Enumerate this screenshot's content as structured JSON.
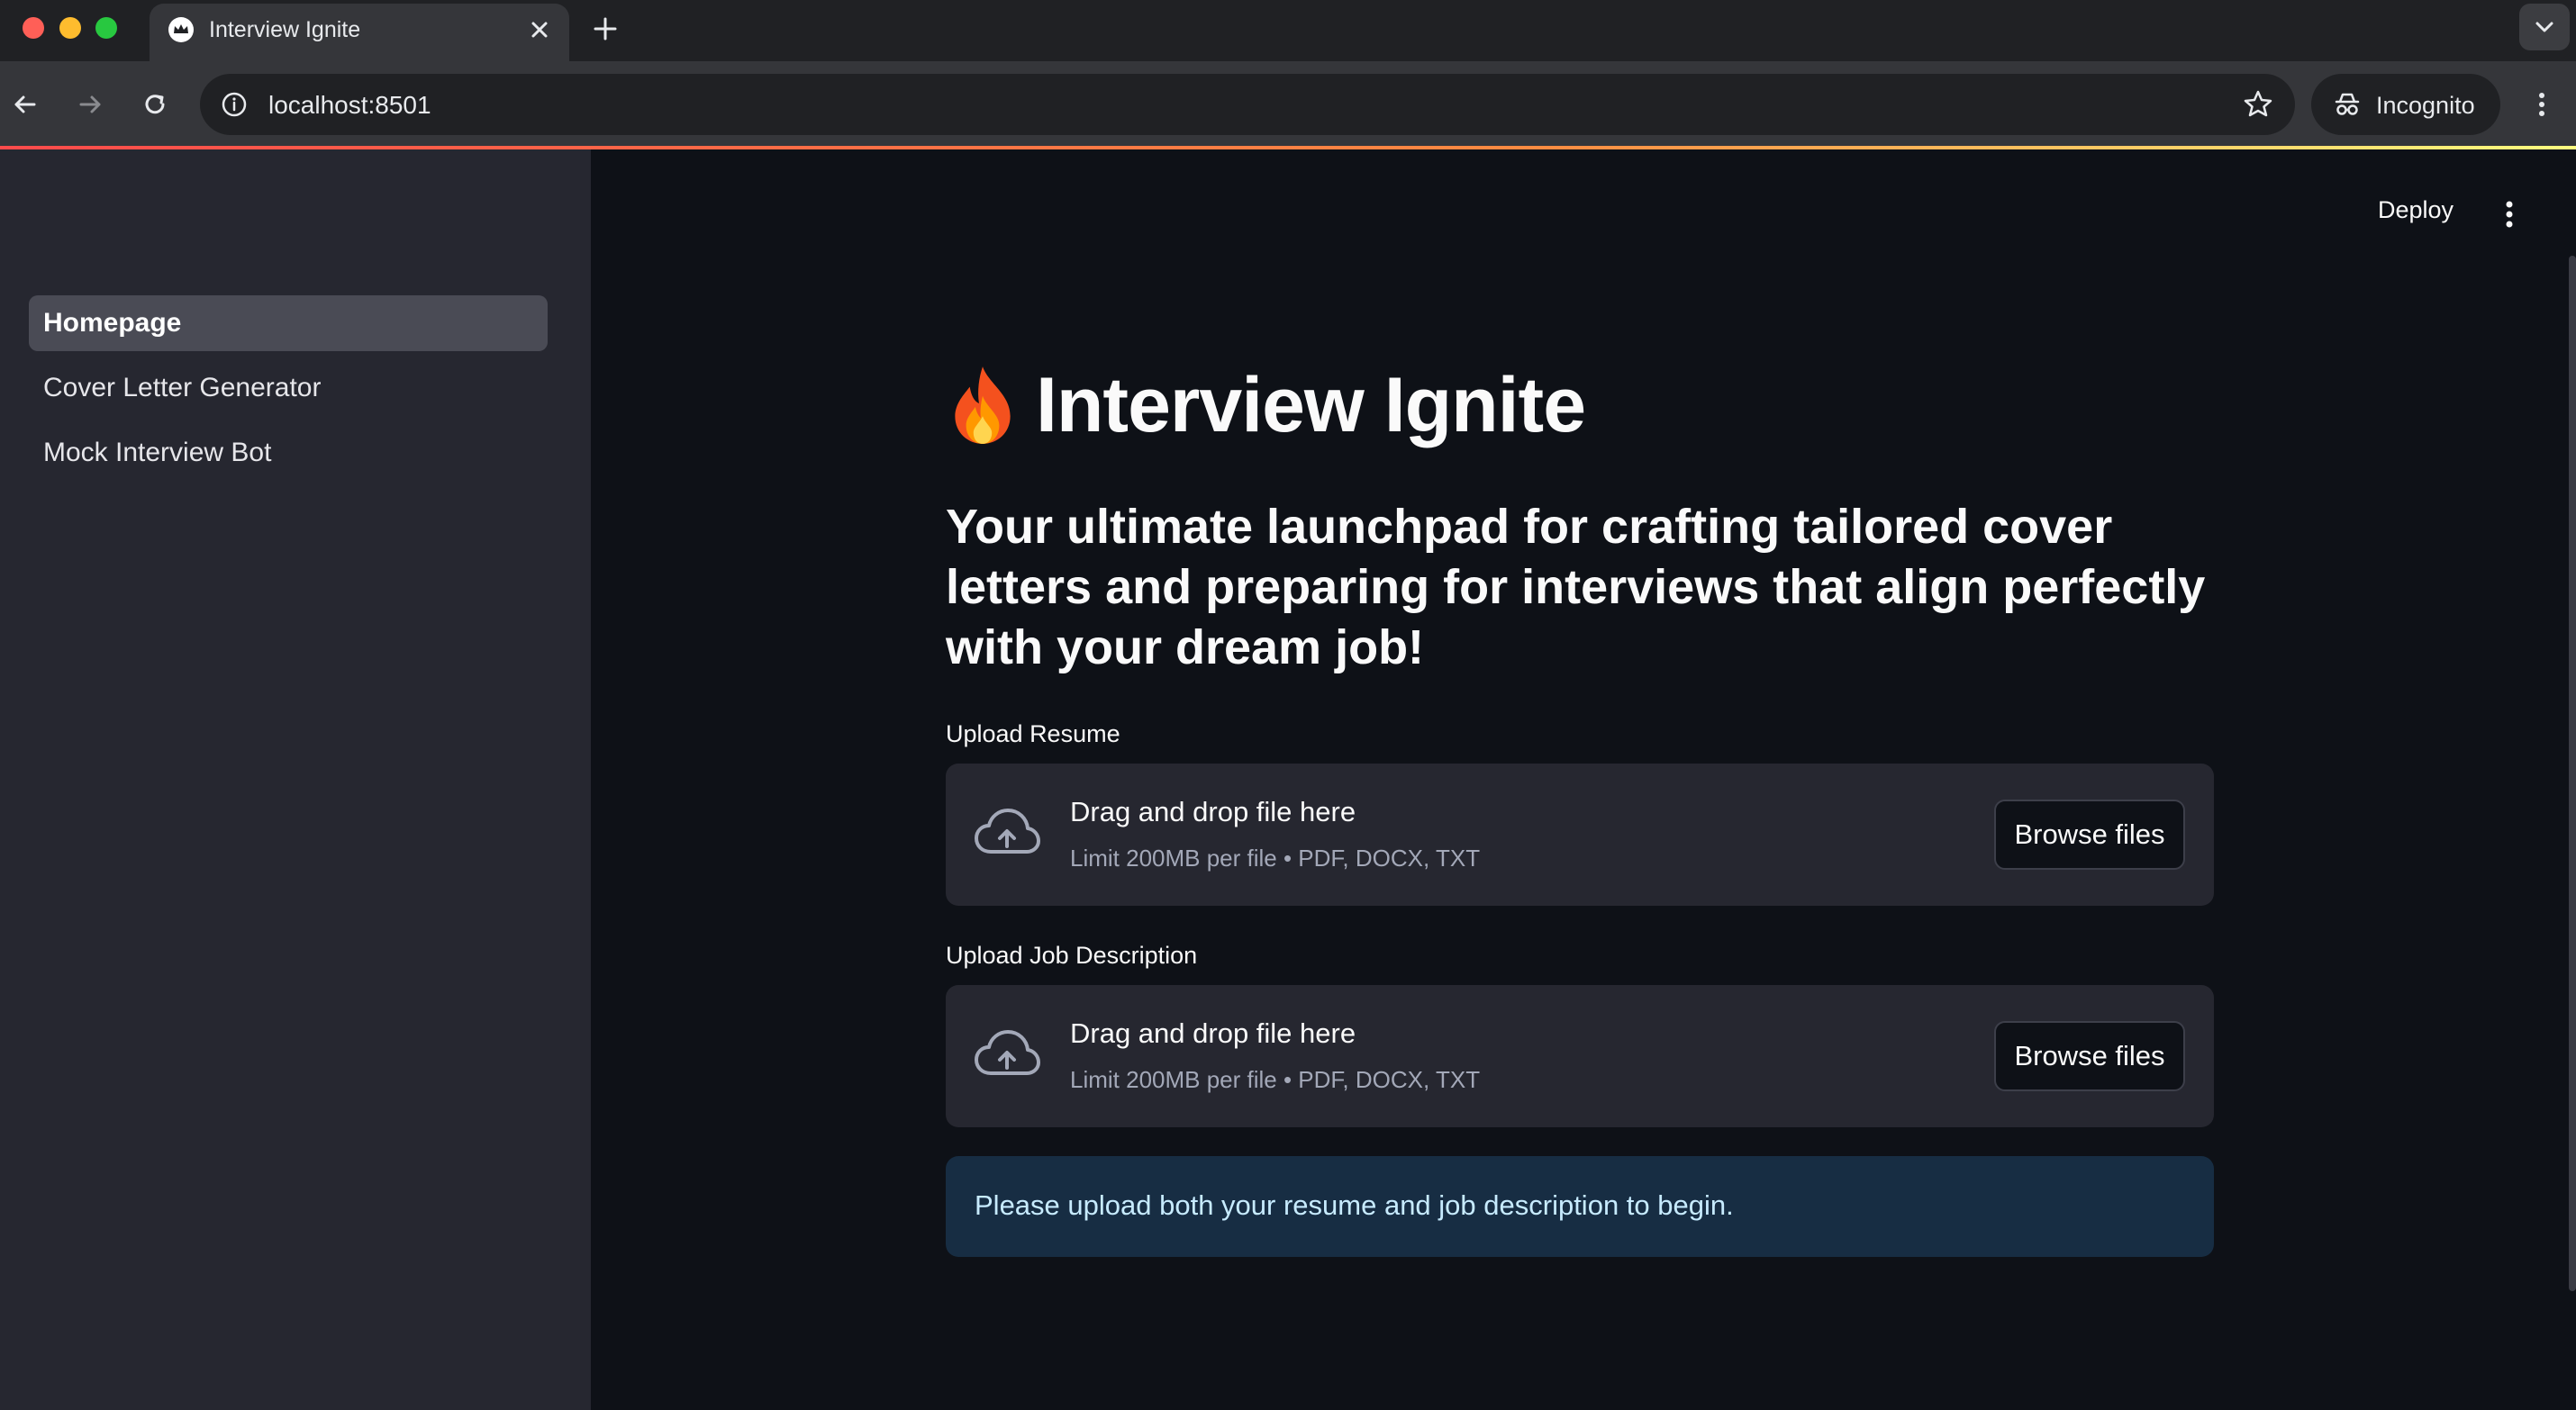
{
  "browser": {
    "tab_title": "Interview Ignite",
    "url": "localhost:8501",
    "profile_label": "Incognito"
  },
  "app": {
    "deploy_label": "Deploy",
    "sidebar": {
      "items": [
        {
          "label": "Homepage",
          "active": true
        },
        {
          "label": "Cover Letter Generator",
          "active": false
        },
        {
          "label": "Mock Interview Bot",
          "active": false
        }
      ]
    },
    "main": {
      "title_emoji": "🔥",
      "title": "Interview Ignite",
      "subtitle": "Your ultimate launchpad for crafting tailored cover letters and preparing for interviews that align perfectly with your dream job!",
      "uploaders": [
        {
          "label": "Upload Resume",
          "drop_text": "Drag and drop file here",
          "limit_text": "Limit 200MB per file • PDF, DOCX, TXT",
          "button_label": "Browse files"
        },
        {
          "label": "Upload Job Description",
          "drop_text": "Drag and drop file here",
          "limit_text": "Limit 200MB per file • PDF, DOCX, TXT",
          "button_label": "Browse files"
        }
      ],
      "info_message": "Please upload both your resume and job description to begin."
    }
  },
  "colors": {
    "app_background": "#0e1117",
    "sidebar_background": "#262730",
    "info_background": "#172d43",
    "info_text": "#c7ebff"
  }
}
